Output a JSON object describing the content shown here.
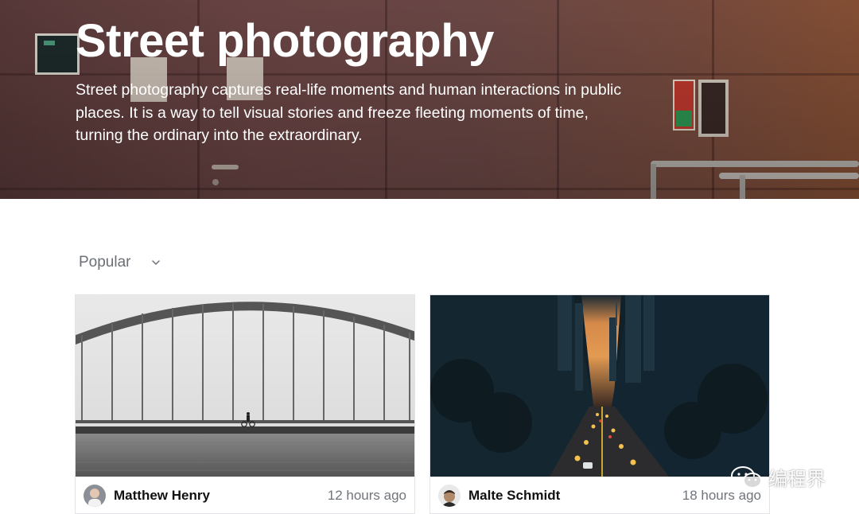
{
  "hero": {
    "title": "Street photography",
    "description": "Street photography captures real-life moments and human interactions in public places. It is a way to tell visual stories and freeze fleeting moments of time, turning the ordinary into the extraordinary."
  },
  "sort": {
    "selected": "Popular",
    "icon": "chevron-down-icon"
  },
  "photos": [
    {
      "author": "Matthew Henry",
      "time": "12 hours ago",
      "image_subject": "bridge-photo",
      "avatar_icon": "avatar"
    },
    {
      "author": "Malte Schmidt",
      "time": "18 hours ago",
      "image_subject": "city-street-photo",
      "avatar_icon": "avatar"
    }
  ],
  "watermark": {
    "text": "编程界",
    "icon": "wechat-icon"
  },
  "colors": {
    "hero_overlay": "#6d4646",
    "muted_text": "#6b6f76",
    "card_border": "#e2e4e8",
    "author_text": "#111111"
  }
}
